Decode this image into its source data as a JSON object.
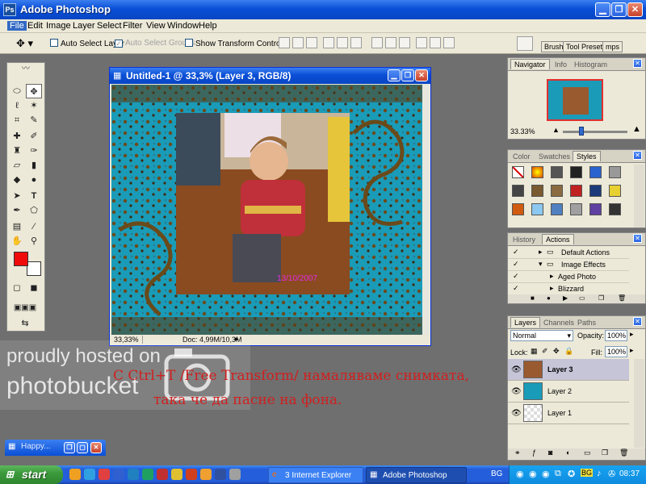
{
  "app": {
    "title": "Adobe Photoshop",
    "icon_text": "Ps"
  },
  "menu": [
    "File",
    "Edit",
    "Image",
    "Layer",
    "Select",
    "Filter",
    "View",
    "Window",
    "Help"
  ],
  "options": {
    "auto_select_layer": "Auto Select Layer",
    "auto_select_groups": "Auto Select Groups",
    "show_transform_controls": "Show Transform Controls",
    "palette_well_tabs": [
      "Brushe",
      "Tool Presets",
      "mps"
    ]
  },
  "document": {
    "title": "Untitled-1 @ 33,3% (Layer 3, RGB/8)",
    "zoom": "33,33%",
    "doc_info": "Doc: 4,99M/10,3M",
    "photo_date": "13/10/2007"
  },
  "watermark": {
    "line1": "proudly hosted on",
    "line2": "photobucket"
  },
  "caption": {
    "line1": "С Ctrl+T /Free Transform/ намаляваме снимката,",
    "line2": "така че да пасне на фона."
  },
  "minimized_window": {
    "title": "Happy..."
  },
  "navigator": {
    "tabs": [
      "Navigator",
      "Info",
      "Histogram"
    ],
    "zoom": "33.33%"
  },
  "swatches": {
    "tabs": [
      "Color",
      "Swatches",
      "Styles"
    ]
  },
  "actions": {
    "tabs": [
      "History",
      "Actions"
    ],
    "items": [
      "Default Actions",
      "Image Effects",
      "Aged Photo",
      "Blizzard"
    ]
  },
  "layers": {
    "tabs": [
      "Layers",
      "Channels",
      "Paths"
    ],
    "blend_mode": "Normal",
    "opacity_label": "Opacity:",
    "opacity": "100%",
    "lock_label": "Lock:",
    "fill_label": "Fill:",
    "fill": "100%",
    "items": [
      "Layer 3",
      "Layer 2",
      "Layer 1"
    ]
  },
  "taskbar": {
    "start": "start",
    "buttons": [
      "3 Internet Explorer",
      "Adobe Photoshop"
    ],
    "language": "BG",
    "language_tray": "BG",
    "clock": "08:37"
  },
  "colors": {
    "foreground": "#f00a0a",
    "background": "#ffffff",
    "accent": "#0a4fd6",
    "canvas_teal": "#1a9bb8"
  }
}
